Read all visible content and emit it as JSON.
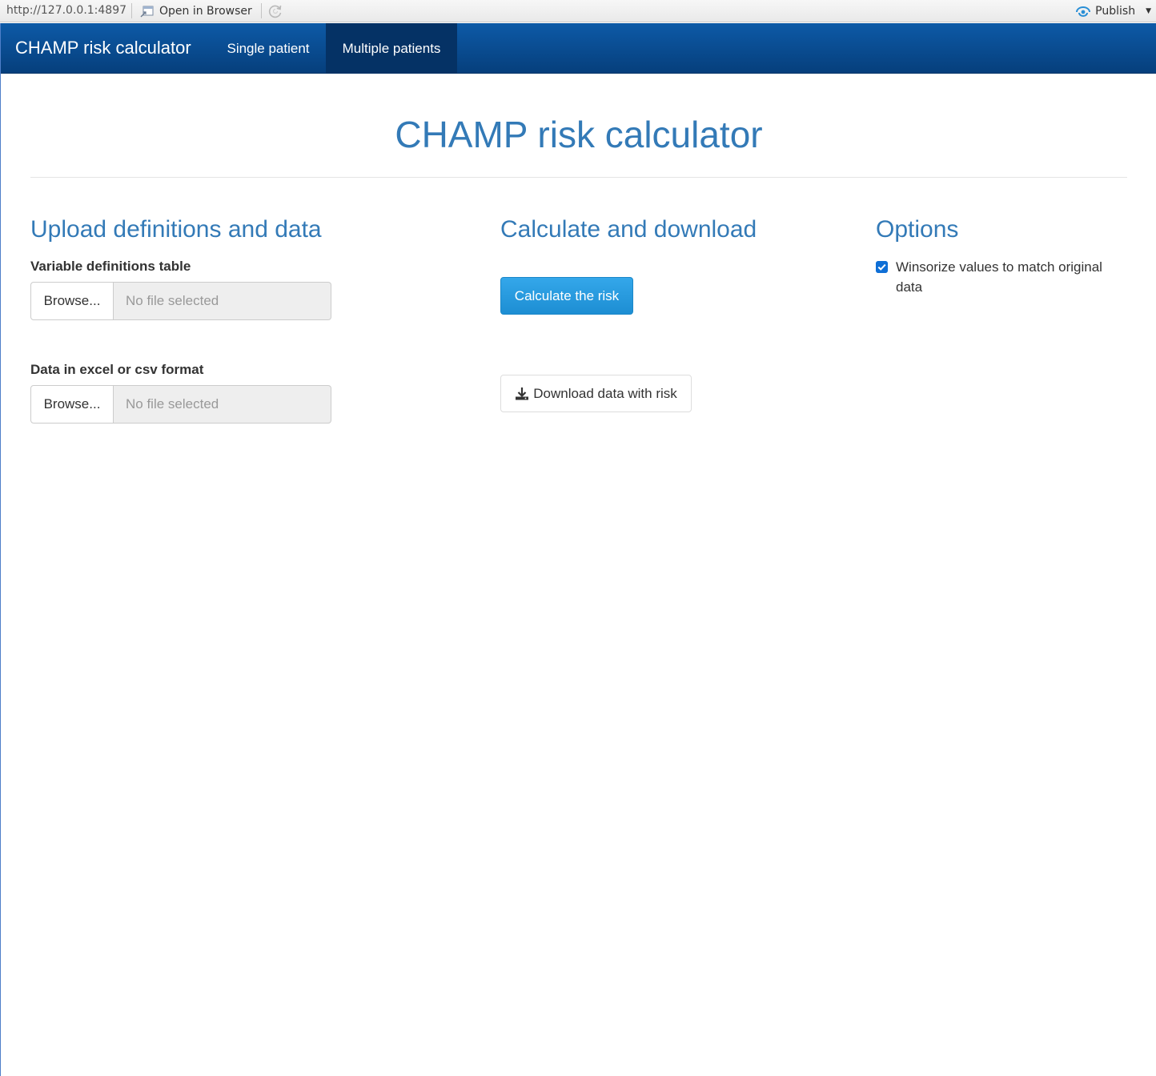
{
  "viewer_toolbar": {
    "url": "http://127.0.0.1:4897",
    "open_in_browser_label": "Open in Browser",
    "publish_label": "Publish"
  },
  "navbar": {
    "brand": "CHAMP risk calculator",
    "tabs": [
      {
        "label": "Single patient",
        "active": false
      },
      {
        "label": "Multiple patients",
        "active": true
      }
    ]
  },
  "page": {
    "title": "CHAMP risk calculator"
  },
  "upload_section": {
    "heading": "Upload definitions and data",
    "definitions_input": {
      "label": "Variable definitions table",
      "button_label": "Browse...",
      "placeholder": "No file selected"
    },
    "data_input": {
      "label": "Data in excel or csv format",
      "button_label": "Browse...",
      "placeholder": "No file selected"
    }
  },
  "calculate_section": {
    "heading": "Calculate and download",
    "calculate_button": "Calculate the risk",
    "download_button": "Download data with risk"
  },
  "options_section": {
    "heading": "Options",
    "winsorize": {
      "label": "Winsorize values to match original data",
      "checked": true
    }
  },
  "colors": {
    "navbar": "#0a4f96",
    "active_tab": "#053265",
    "heading": "#337ab7",
    "primary_button": "#2a9de0"
  }
}
